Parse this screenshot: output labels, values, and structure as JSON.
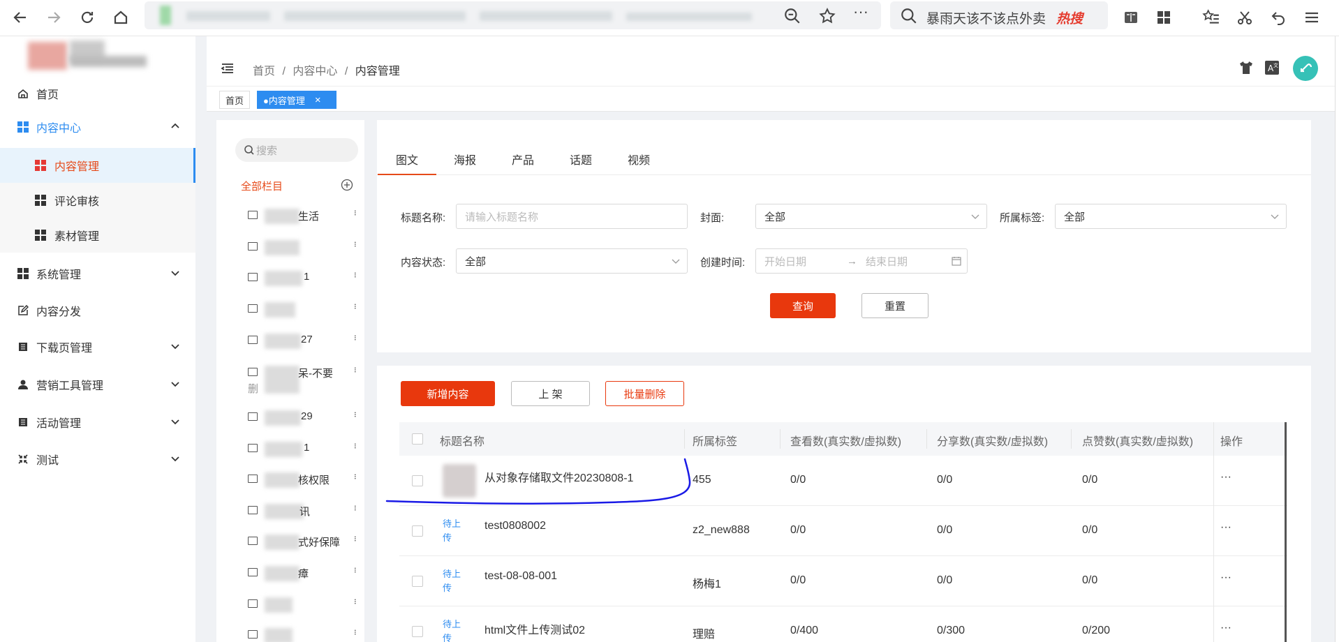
{
  "browser": {
    "search_text": "暴雨天该不该点外卖",
    "hot_label": "热搜"
  },
  "sidebar": {
    "items": [
      {
        "label": "首页"
      },
      {
        "label": "内容中心"
      },
      {
        "label": "内容管理"
      },
      {
        "label": "评论审核"
      },
      {
        "label": "素材管理"
      },
      {
        "label": "系统管理"
      },
      {
        "label": "内容分发"
      },
      {
        "label": "下载页管理"
      },
      {
        "label": "营销工具管理"
      },
      {
        "label": "活动管理"
      },
      {
        "label": "测试"
      }
    ]
  },
  "header": {
    "breadcrumb": [
      "首页",
      "内容中心",
      "内容管理"
    ],
    "separator": "/"
  },
  "tags": {
    "home": "首页",
    "active": "●内容管理",
    "close": "×"
  },
  "tree": {
    "search_placeholder": "搜索",
    "all_label": "全部栏目",
    "rows": [
      {
        "suffix": "生活"
      },
      {
        "suffix": ""
      },
      {
        "suffix": "1"
      },
      {
        "suffix": ""
      },
      {
        "suffix": "27"
      },
      {
        "suffix": "呆-不要"
      },
      {
        "suffix": "29"
      },
      {
        "suffix": "1"
      },
      {
        "suffix": "核权限"
      },
      {
        "suffix": "讯"
      },
      {
        "suffix": "式好保障"
      },
      {
        "suffix": "瘴"
      },
      {
        "suffix": ""
      },
      {
        "suffix": ""
      }
    ],
    "row6_extra": "删"
  },
  "tabs": [
    "图文",
    "海报",
    "产品",
    "话题",
    "视频"
  ],
  "filters": {
    "title_label": "标题名称:",
    "title_placeholder": "请输入标题名称",
    "cover_label": "封面:",
    "cover_value": "全部",
    "tag_label": "所属标签:",
    "tag_value": "全部",
    "status_label": "内容状态:",
    "status_value": "全部",
    "time_label": "创建时间:",
    "start_placeholder": "开始日期",
    "arrow": "→",
    "end_placeholder": "结束日期",
    "query_button": "查询",
    "reset_button": "重置"
  },
  "actions": {
    "add": "新增内容",
    "publish": "上 架",
    "batch_delete": "批量删除"
  },
  "table": {
    "columns": [
      "标题名称",
      "所属标签",
      "查看数(真实数/虚拟数)",
      "分享数(真实数/虚拟数)",
      "点赞数(真实数/虚拟数)",
      "操作"
    ],
    "rows": [
      {
        "status": "",
        "title": "从对象存储取文件20230808-1",
        "tag": "455",
        "views": "0/0",
        "shares": "0/0",
        "likes": "0/0",
        "op": "···"
      },
      {
        "status": "待上传",
        "title": "test0808002",
        "tag": "z2_new888",
        "views": "0/0",
        "shares": "0/0",
        "likes": "0/0",
        "op": "···"
      },
      {
        "status": "待上传",
        "title": "test-08-08-001",
        "tag": "杨梅1",
        "views": "0/0",
        "shares": "0/0",
        "likes": "0/0",
        "op": "···"
      },
      {
        "status": "待上传",
        "title": "html文件上传测试02",
        "tag": "理赔",
        "views": "0/400",
        "shares": "0/300",
        "likes": "0/200",
        "op": "···"
      }
    ]
  },
  "colors": {
    "accent": "#e8380d",
    "active_menu": "#e64a19",
    "link_blue": "#2d8cf0",
    "annotation": "#1a1ae6"
  }
}
